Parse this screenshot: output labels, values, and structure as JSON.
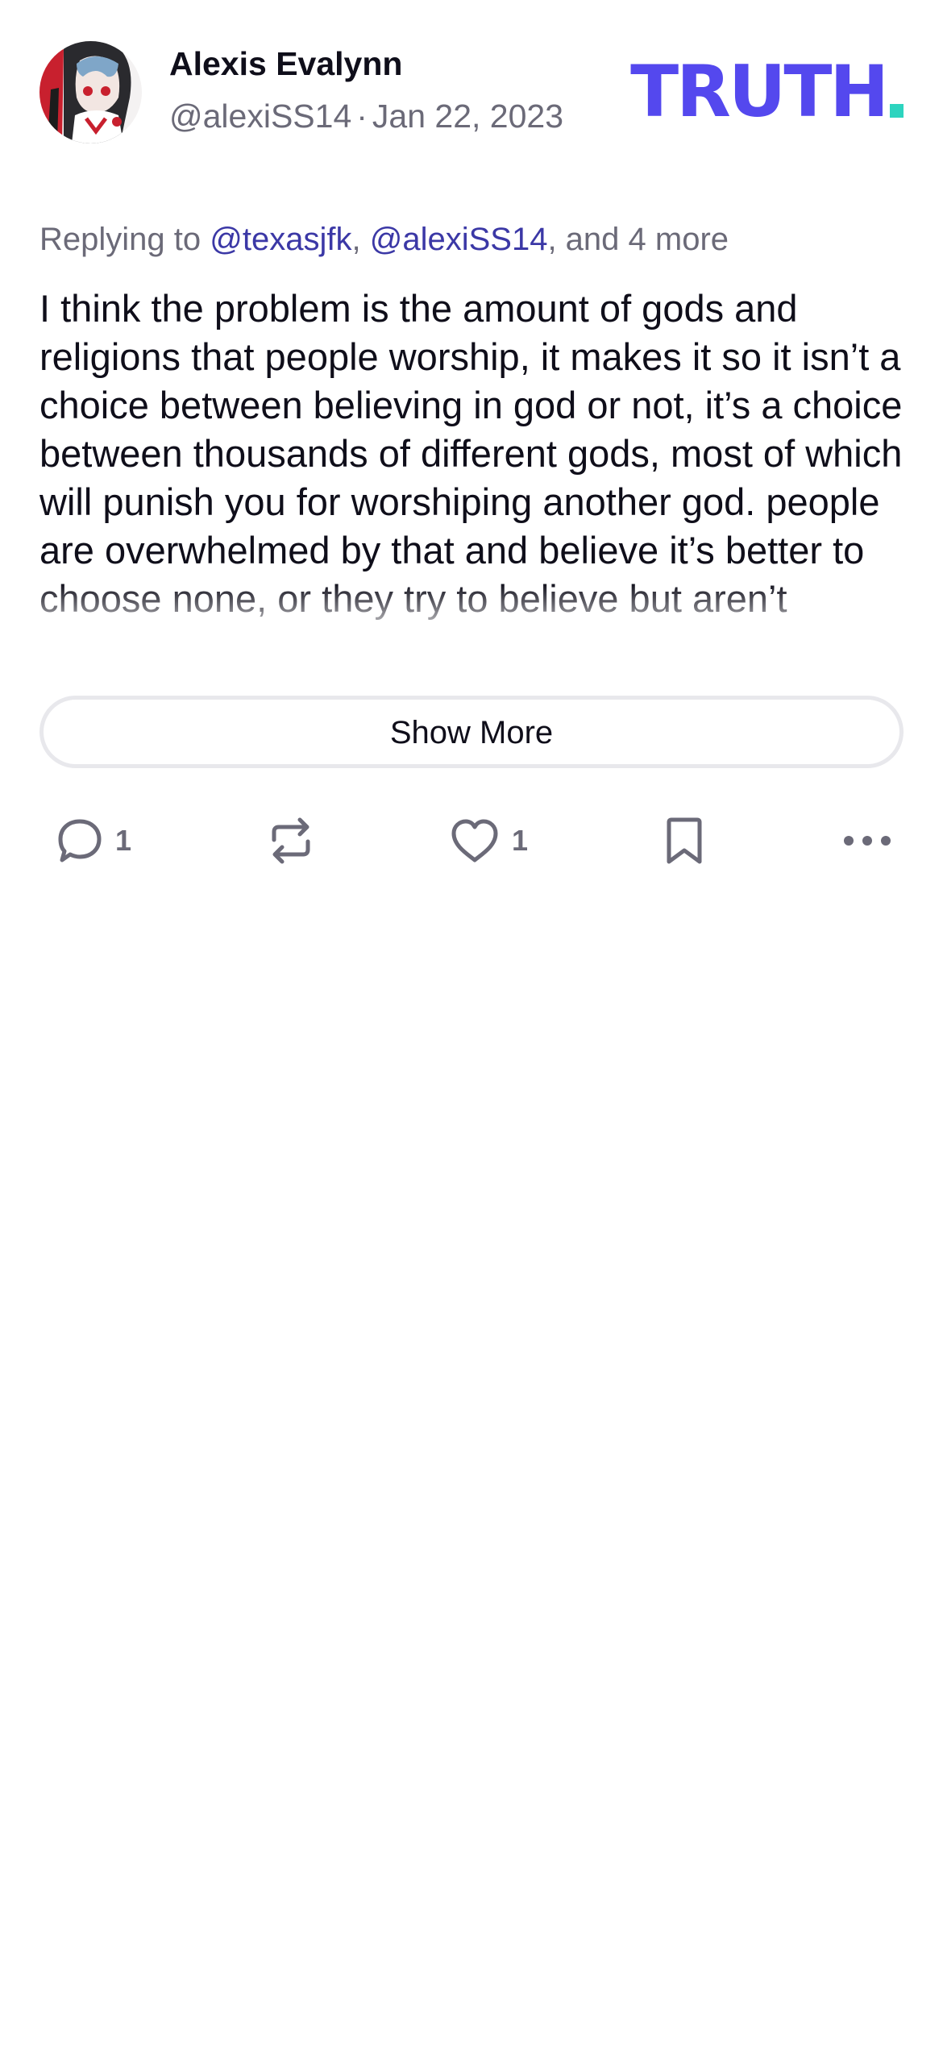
{
  "post": {
    "author": {
      "display_name": "Alexis Evalynn",
      "handle": "@alexiSS14",
      "separator": "·",
      "date": "Jan 22, 2023"
    },
    "logo": {
      "word": "TRUTH",
      "brand_color": "#5448ee",
      "dot_color": "#2dd4bf"
    },
    "replying": {
      "prefix": "Replying to",
      "mention_1": "@texasjfk",
      "comma": ",",
      "mention_2": "@alexiSS14",
      "suffix": ", and 4 more"
    },
    "content": "I think the problem is the amount of gods and religions that people worship, it makes it so it isn’t a choice between believing in god or not, it’s a choice between thousands of different gods, most of which will punish you for worshiping another god. people are overwhelmed by that and believe it’s better to choose none, or they try to believe but aren’t",
    "show_more_label": "Show More",
    "actions": {
      "reply": {
        "icon": "comment-icon",
        "count": "1"
      },
      "repost": {
        "icon": "repost-icon"
      },
      "like": {
        "icon": "heart-icon",
        "count": "1"
      },
      "bookmark": {
        "icon": "bookmark-icon"
      },
      "more": {
        "icon": "more-icon"
      }
    }
  }
}
